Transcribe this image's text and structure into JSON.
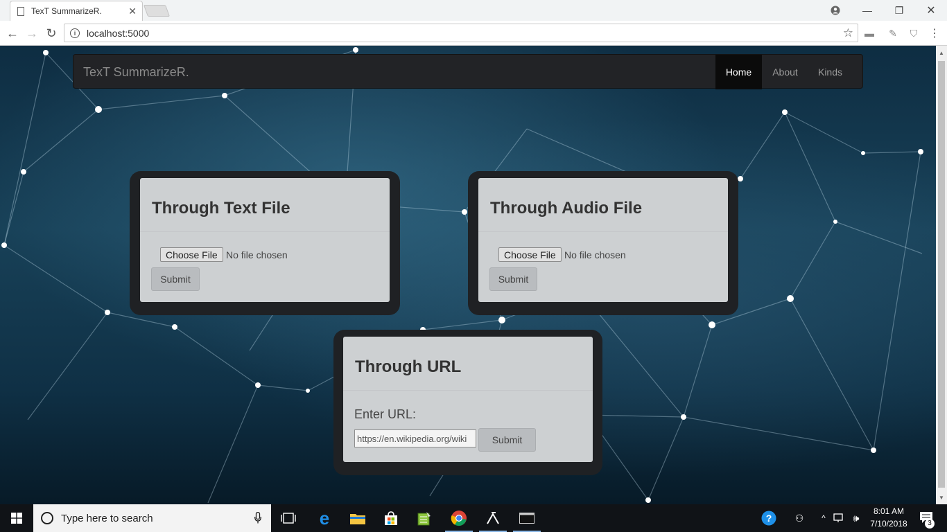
{
  "browser": {
    "tab_title": "TexT SummarizeR.",
    "address": "localhost:5000",
    "window_controls": [
      "minimize-icon",
      "restore-icon",
      "close-icon"
    ]
  },
  "navbar": {
    "brand": "TexT SummarizeR.",
    "items": [
      {
        "label": "Home",
        "active": true
      },
      {
        "label": "About",
        "active": false
      },
      {
        "label": "Kinds",
        "active": false
      }
    ]
  },
  "cards": {
    "text_file": {
      "title": "Through Text File",
      "choose_label": "Choose File",
      "status": "No file chosen",
      "submit_label": "Submit"
    },
    "audio_file": {
      "title": "Through Audio File",
      "choose_label": "Choose File",
      "status": "No file chosen",
      "submit_label": "Submit"
    },
    "url": {
      "title": "Through URL",
      "label": "Enter URL:",
      "input_value": "https://en.wikipedia.org/wiki",
      "submit_label": "Submit"
    }
  },
  "taskbar": {
    "search_placeholder": "Type here to search",
    "time": "8:01 AM",
    "date": "7/10/2018",
    "notification_count": "3",
    "apps": [
      "start-icon",
      "cortana-icon",
      "mic-icon",
      "task-view-icon",
      "edge-icon",
      "file-explorer-icon",
      "store-icon",
      "notepad-icon",
      "chrome-icon",
      "code-icon",
      "terminal-icon"
    ]
  },
  "colors": {
    "navbar_bg": "#222326",
    "active_nav_bg": "#0b0b0b",
    "card_frame": "#1f2124",
    "card_bg": "#e6e8eb",
    "page_bg_dark": "#0e2d42"
  }
}
